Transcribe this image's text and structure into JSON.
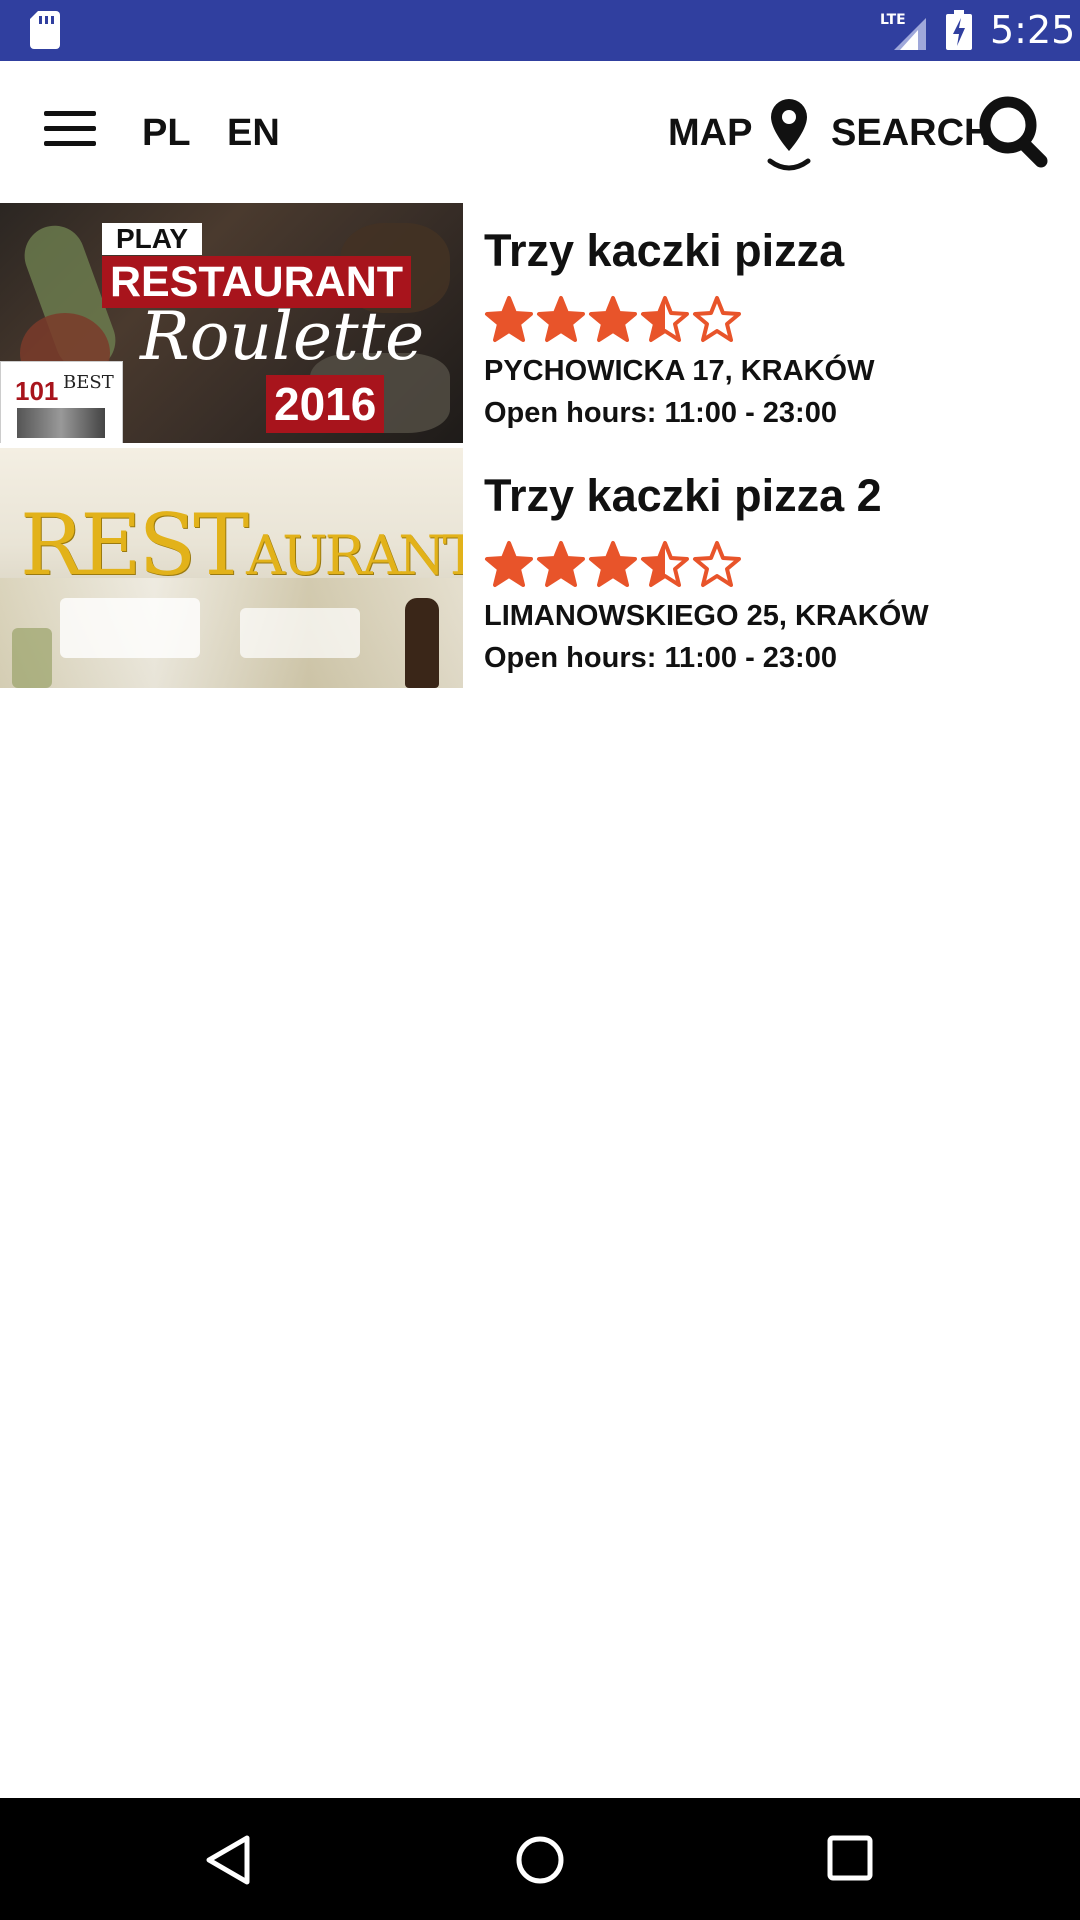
{
  "status_bar": {
    "time": "5:25",
    "network": "LTE",
    "icons": [
      "sd-card-icon",
      "lte-signal-icon",
      "battery-charging-icon"
    ]
  },
  "app_bar": {
    "menu_icon": "hamburger-menu-icon",
    "lang_pl": "PL",
    "lang_en": "EN",
    "map_label": "MAP",
    "map_icon": "map-pin-icon",
    "search_label": "SEARCH",
    "search_icon": "magnifier-icon"
  },
  "restaurants": [
    {
      "name": "Trzy kaczki pizza",
      "rating": 3.5,
      "rating_max": 5,
      "address": "PYCHOWICKA 17, KRAKÓW",
      "hours": "Open hours: 11:00 - 23:00",
      "image_text": {
        "play": "PLAY",
        "restaurant": "RESTAURANT",
        "roulette": "Roulette",
        "year": "2016",
        "badge_number": "101",
        "badge_word": "BEST"
      }
    },
    {
      "name": "Trzy kaczki pizza 2",
      "rating": 3.5,
      "rating_max": 5,
      "address": "LIMANOWSKIEGO 25, KRAKÓW",
      "hours": "Open hours: 11:00 - 23:00",
      "image_text": {
        "word_big": "REST",
        "word_small": "AURANT"
      }
    }
  ],
  "colors": {
    "status_bar": "#303f9f",
    "star": "#e8542a",
    "brand_red": "#a8141c",
    "text": "#111111",
    "nav_bar": "#000000"
  },
  "nav_bar": {
    "icons": [
      "back-icon",
      "home-icon",
      "recents-icon"
    ]
  }
}
